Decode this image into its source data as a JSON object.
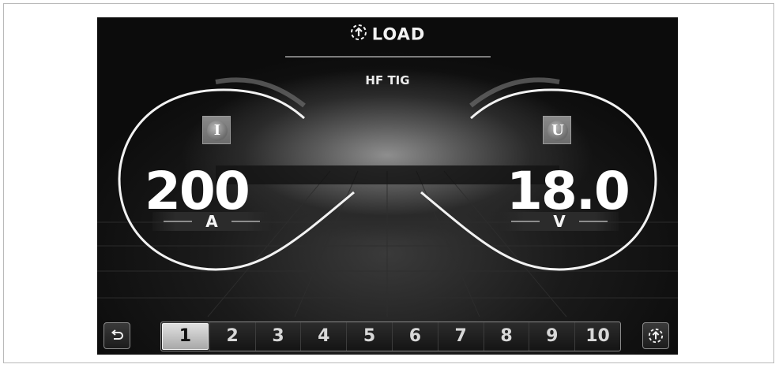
{
  "header": {
    "title": "LOAD",
    "icon": "load-icon"
  },
  "mode": "HF TIG",
  "current": {
    "symbol": "I",
    "value": "200",
    "unit": "A"
  },
  "voltage": {
    "symbol": "U",
    "value": "18.0",
    "unit": "V"
  },
  "memory": {
    "slots": [
      "1",
      "2",
      "3",
      "4",
      "5",
      "6",
      "7",
      "8",
      "9",
      "10"
    ],
    "active": "1"
  },
  "buttons": {
    "back_icon": "back-arrow-icon",
    "load_icon": "load-icon"
  },
  "colors": {
    "screen_bg": "#0b0b0b",
    "text": "#ffffff",
    "accent": "#8d8d8d"
  }
}
